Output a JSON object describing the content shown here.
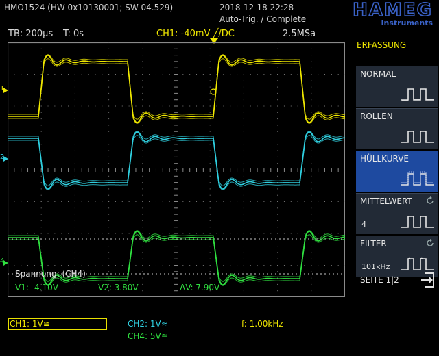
{
  "header": {
    "device": "HMO1524 (HW 0x10130001; SW 04.529)",
    "datetime": "2018-12-18 22:28",
    "status": "Auto-Trig. / Complete",
    "brand": "HAMEG",
    "brand_sub": "Instruments"
  },
  "info_bar": {
    "timebase": "TB: 200µs",
    "trigger_time": "T: 0s",
    "trigger_info": "CH1: -40mV ╱/DC",
    "sample_rate": "2.5MSa"
  },
  "sidebar": {
    "title": "ERFASSUNG",
    "buttons": [
      {
        "label": "NORMAL",
        "value": "",
        "active": false
      },
      {
        "label": "ROLLEN",
        "value": "",
        "active": false
      },
      {
        "label": "HÜLLKURVE",
        "value": "",
        "active": true
      },
      {
        "label": "MITTELWERT",
        "value": "4",
        "active": false
      },
      {
        "label": "FILTER",
        "value": "101kHz",
        "active": false
      }
    ],
    "page": "SEITE 1|2"
  },
  "measurement": {
    "title": "Spannung: (CH4)",
    "v1": "V1: -4.10V",
    "v2": "V2: 3.80V",
    "dv": "ΔV: 7.90V"
  },
  "channels": {
    "ch1": "CH1: 1V≅",
    "ch2": "CH2: 1V≈",
    "ch4": "CH4: 5V≅",
    "freq": "f: 1.00kHz"
  },
  "markers": {
    "ch1": "1",
    "ch2": "2",
    "ch4": "4"
  },
  "colors": {
    "ch1": "#f0e800",
    "ch2": "#30d0e0",
    "ch4": "#30e040",
    "ui_blue": "#1e4aa0"
  }
}
